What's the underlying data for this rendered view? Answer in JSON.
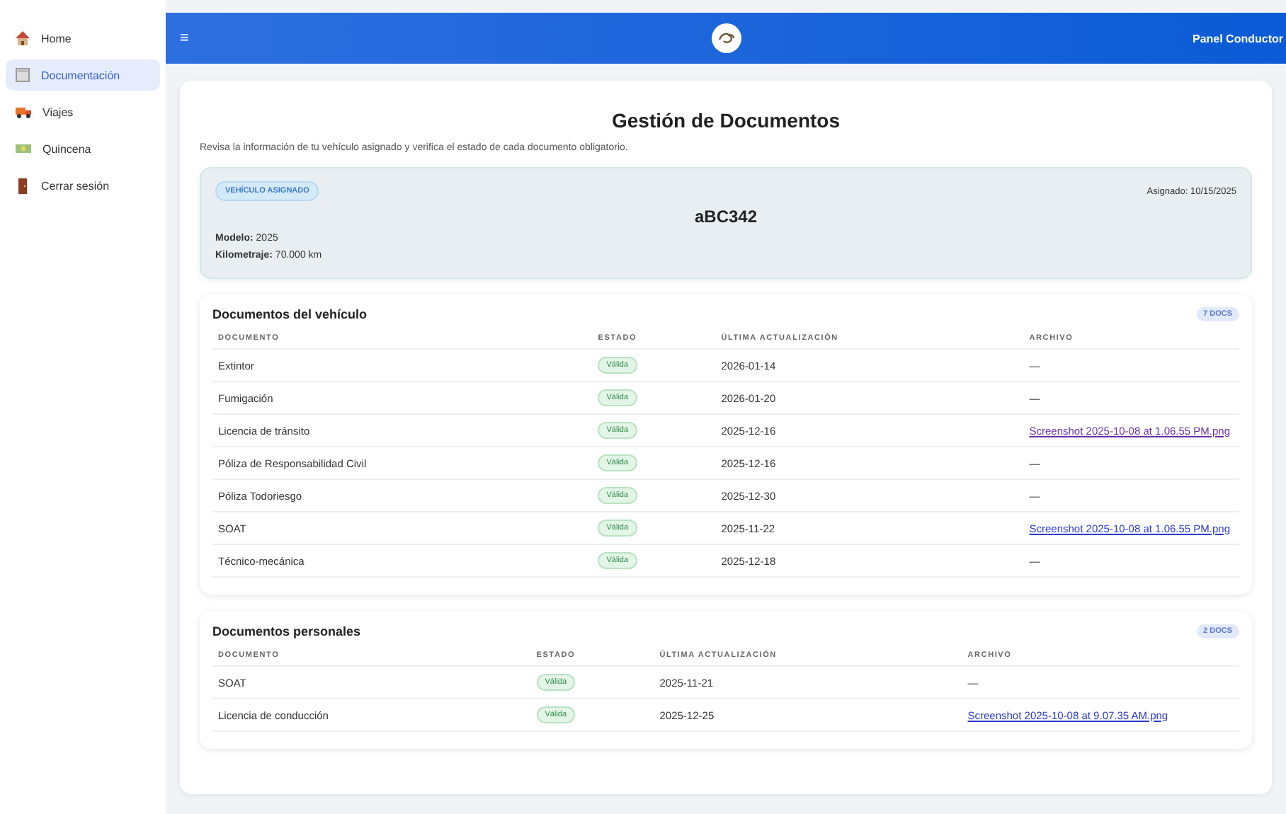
{
  "sidebar": {
    "items": [
      {
        "label": "Home",
        "selected": false
      },
      {
        "label": "Documentación",
        "selected": true
      },
      {
        "label": "Viajes",
        "selected": false
      },
      {
        "label": "Quincena",
        "selected": false
      },
      {
        "label": "Cerrar sesión",
        "selected": false
      }
    ]
  },
  "header": {
    "menu_glyph": "≡",
    "panel_title": "Panel Conductor"
  },
  "page": {
    "title": "Gestión de Documentos",
    "description": "Revisa la información de tu vehículo asignado y verifica el estado de cada documento obligatorio."
  },
  "vehicle": {
    "badge": "VEHÍCULO ASIGNADO",
    "assigned": "Asignado: 10/15/2025",
    "plate": "aBC342",
    "details": [
      {
        "label": "Modelo:",
        "value": "2025"
      },
      {
        "label": "Kilometraje:",
        "value": "70.000 km"
      }
    ]
  },
  "sections": [
    {
      "title": "Documentos del vehículo",
      "count": "7 DOCS",
      "columns": [
        "DOCUMENTO",
        "ESTADO",
        "ÚLTIMA ACTUALIZACIÓN",
        "ARCHIVO"
      ],
      "rows": [
        {
          "document": "Extintor",
          "status": "Válida",
          "updated": "2026-01-14",
          "file": "—",
          "kind": "none"
        },
        {
          "document": "Fumigación",
          "status": "Válida",
          "updated": "2026-01-20",
          "file": "—",
          "kind": "none"
        },
        {
          "document": "Licencia de tránsito",
          "status": "Válida",
          "updated": "2025-12-16",
          "file": "Screenshot 2025-10-08 at 1.06.55 PM.png",
          "kind": "link",
          "visited": true
        },
        {
          "document": "Póliza de Responsabilidad Civil",
          "status": "Válida",
          "updated": "2025-12-16",
          "file": "—",
          "kind": "none"
        },
        {
          "document": "Póliza Todoriesgo",
          "status": "Válida",
          "updated": "2025-12-30",
          "file": "—",
          "kind": "none"
        },
        {
          "document": "SOAT",
          "status": "Válida",
          "updated": "2025-11-22",
          "file": "Screenshot 2025-10-08 at 1.06.55 PM.png",
          "kind": "link",
          "visited": false
        },
        {
          "document": "Técnico-mecánica",
          "status": "Válida",
          "updated": "2025-12-18",
          "file": "—",
          "kind": "none"
        }
      ]
    },
    {
      "title": "Documentos personales",
      "count": "2 DOCS",
      "columns": [
        "DOCUMENTO",
        "ESTADO",
        "ÚLTIMA ACTUALIZACIÓN",
        "ARCHIVO"
      ],
      "rows": [
        {
          "document": "SOAT",
          "status": "Válida",
          "updated": "2025-11-21",
          "file": "—",
          "kind": "none"
        },
        {
          "document": "Licencia de conducción",
          "status": "Válida",
          "updated": "2025-12-25",
          "file": "Screenshot 2025-10-08 at 9.07.35 AM.png",
          "kind": "link",
          "visited": false
        }
      ]
    }
  ]
}
